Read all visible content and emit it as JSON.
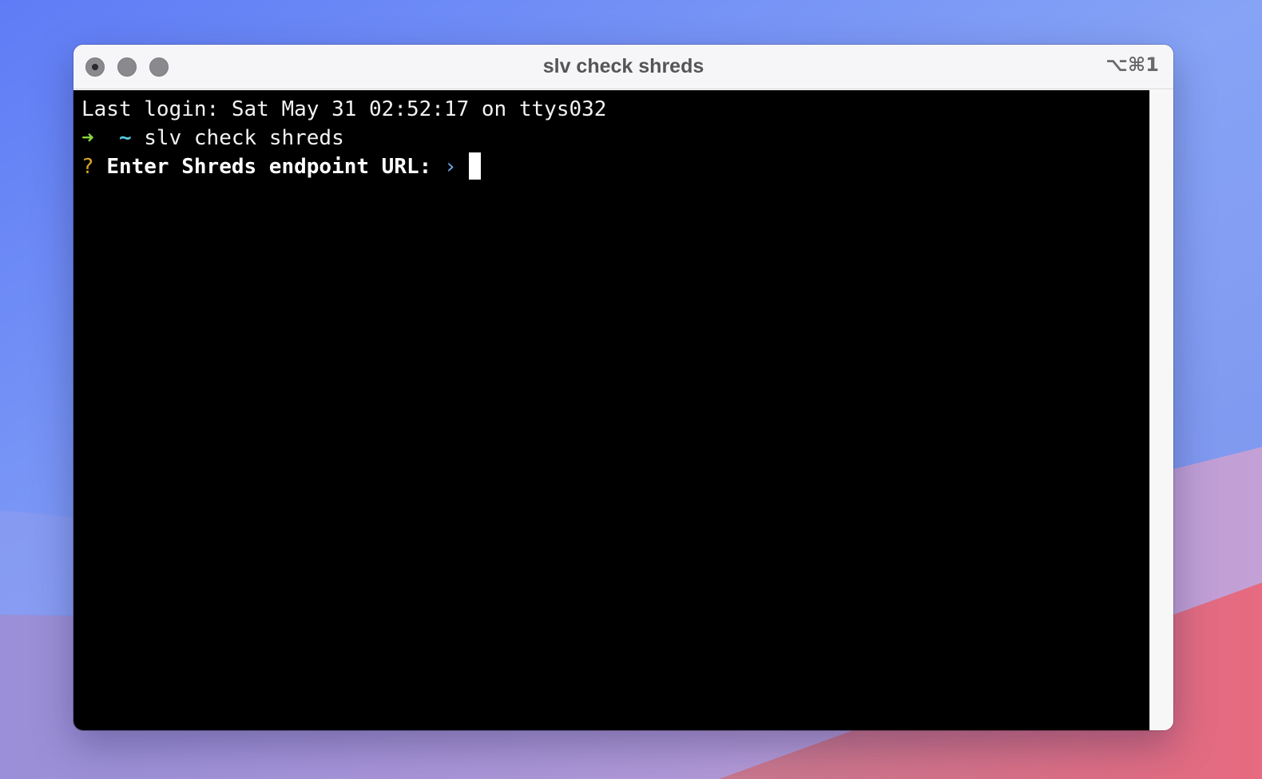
{
  "window": {
    "title": "slv check shreds",
    "shortcut": "⌥⌘1"
  },
  "terminal": {
    "last_login": "Last login: Sat May 31 02:52:17 on ttys032",
    "prompt_arrow": "➜",
    "prompt_dir": "~",
    "command": "slv check shreds",
    "question_mark": "?",
    "question": "Enter Shreds endpoint URL:",
    "input_chevron": "›",
    "input_value": ""
  },
  "colors": {
    "arrow": "#8bd73f",
    "tilde": "#56c9e0",
    "question_mark": "#d8a423",
    "chevron": "#6fa8e6",
    "terminal_bg": "#000000"
  }
}
